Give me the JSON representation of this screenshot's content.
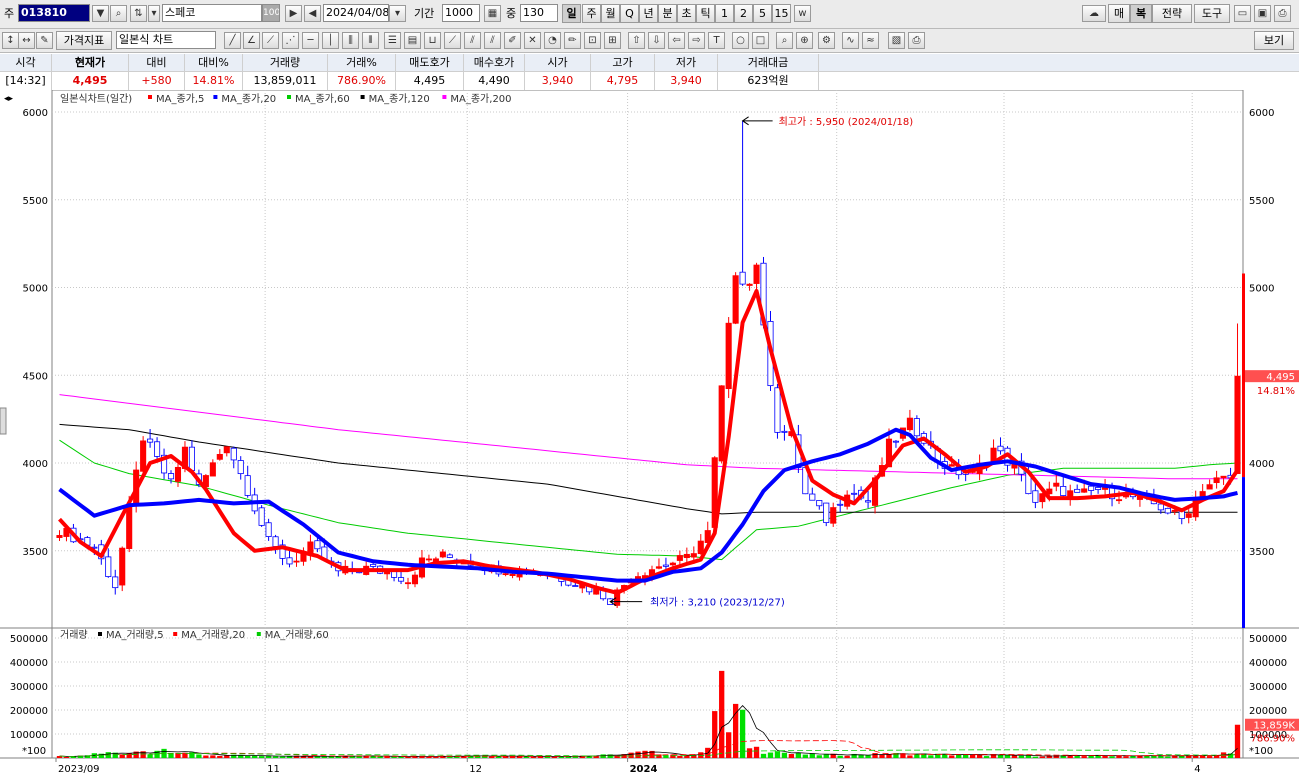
{
  "toolbar": {
    "type_label": "주",
    "code": "013810",
    "name": "스페코",
    "ratio_box": "100",
    "date": "2024/04/08",
    "period_label": "기간",
    "period_value": "1000",
    "count_label": "중",
    "count_value": "130",
    "period_tabs": [
      "일",
      "주",
      "월",
      "Q",
      "년",
      "분",
      "초",
      "틱",
      "1",
      "2",
      "5",
      "15"
    ],
    "right_buttons": [
      "매",
      "복",
      "전략",
      "도구"
    ],
    "price_indicator": "가격지표",
    "chart_style": "일본식 차트",
    "view_button": "보기"
  },
  "quote": {
    "headers": [
      "시각",
      "현재가",
      "대비",
      "대비%",
      "거래량",
      "거래%",
      "매도호가",
      "매수호가",
      "시가",
      "고가",
      "저가",
      "거래대금"
    ],
    "values": [
      "[14:32]",
      "4,495",
      "+580",
      "14.81%",
      "13,859,011",
      "786.90%",
      "4,495",
      "4,490",
      "3,940",
      "4,795",
      "3,940",
      "623억원"
    ]
  },
  "colors": {
    "up": "#ff0000",
    "down": "#0000ff",
    "ma5": "#ff0000",
    "ma20": "#0000ff",
    "ma60": "#00cc00",
    "ma120": "#000000",
    "ma200": "#ff00ff"
  },
  "chart_data": {
    "type": "candlestick",
    "title": "일본식차트(일간)",
    "legend": [
      "MA_종가,5",
      "MA_종가,20",
      "MA_종가,60",
      "MA_종가,120",
      "MA_종가,200"
    ],
    "ylim": [
      3060,
      6080
    ],
    "yticks": [
      3500,
      4000,
      4500,
      5000,
      5500,
      6000
    ],
    "ytick_labels": [
      "3500",
      "4000",
      "4500",
      "5000",
      "5500",
      "6000"
    ],
    "x_labels": [
      "2023/09",
      "11",
      "12",
      "2024",
      "2",
      "3",
      "4"
    ],
    "x_label_index": [
      0,
      30,
      59,
      82,
      112,
      136,
      163
    ],
    "n_days": 170,
    "annotations": {
      "high": "최고가 : 5,950 (2024/01/18)",
      "low": "최저가 : 3,210 (2023/12/27)"
    },
    "current_price_tag": "4,495",
    "current_change_tag": "14.81%",
    "key_points": {
      "high_price": 5950,
      "high_index": 98,
      "low_price": 3210,
      "low_index": 79,
      "last_close": 4495,
      "last_high": 4795,
      "last_low": 3940,
      "last_open": 3940
    },
    "close_anchors": [
      [
        0,
        3620
      ],
      [
        5,
        3520
      ],
      [
        8,
        3300
      ],
      [
        12,
        4150
      ],
      [
        16,
        3880
      ],
      [
        18,
        4080
      ],
      [
        20,
        3860
      ],
      [
        24,
        4120
      ],
      [
        27,
        3850
      ],
      [
        30,
        3550
      ],
      [
        33,
        3430
      ],
      [
        36,
        3520
      ],
      [
        40,
        3380
      ],
      [
        44,
        3400
      ],
      [
        48,
        3370
      ],
      [
        50,
        3330
      ],
      [
        52,
        3440
      ],
      [
        55,
        3470
      ],
      [
        58,
        3450
      ],
      [
        62,
        3400
      ],
      [
        66,
        3390
      ],
      [
        70,
        3370
      ],
      [
        74,
        3320
      ],
      [
        77,
        3270
      ],
      [
        79,
        3220
      ],
      [
        82,
        3350
      ],
      [
        85,
        3400
      ],
      [
        87,
        3420
      ],
      [
        90,
        3460
      ],
      [
        93,
        3600
      ],
      [
        95,
        4420
      ],
      [
        97,
        5100
      ],
      [
        99,
        5020
      ],
      [
        100,
        5150
      ],
      [
        101,
        4750
      ],
      [
        103,
        4200
      ],
      [
        105,
        4150
      ],
      [
        107,
        3820
      ],
      [
        110,
        3680
      ],
      [
        113,
        3850
      ],
      [
        116,
        3780
      ],
      [
        119,
        4100
      ],
      [
        122,
        4220
      ],
      [
        124,
        4150
      ],
      [
        126,
        4020
      ],
      [
        128,
        3960
      ],
      [
        131,
        3930
      ],
      [
        134,
        4080
      ],
      [
        137,
        3980
      ],
      [
        140,
        3780
      ],
      [
        143,
        3860
      ],
      [
        146,
        3810
      ],
      [
        149,
        3850
      ],
      [
        152,
        3820
      ],
      [
        155,
        3800
      ],
      [
        158,
        3750
      ],
      [
        161,
        3680
      ],
      [
        164,
        3860
      ],
      [
        166,
        3900
      ],
      [
        168,
        3915
      ],
      [
        169,
        4495
      ]
    ],
    "ma": [
      {
        "name": "MA_종가,5",
        "color": "#ff0000",
        "points": [
          [
            0,
            3680
          ],
          [
            3,
            3550
          ],
          [
            6,
            3470
          ],
          [
            9,
            3700
          ],
          [
            13,
            4000
          ],
          [
            16,
            4040
          ],
          [
            19,
            3950
          ],
          [
            21,
            3850
          ],
          [
            25,
            3600
          ],
          [
            28,
            3500
          ],
          [
            32,
            3520
          ],
          [
            37,
            3470
          ],
          [
            41,
            3390
          ],
          [
            46,
            3390
          ],
          [
            50,
            3390
          ],
          [
            54,
            3430
          ],
          [
            58,
            3440
          ],
          [
            62,
            3410
          ],
          [
            68,
            3380
          ],
          [
            73,
            3340
          ],
          [
            77,
            3290
          ],
          [
            80,
            3260
          ],
          [
            84,
            3340
          ],
          [
            88,
            3400
          ],
          [
            92,
            3450
          ],
          [
            94,
            3600
          ],
          [
            96,
            4150
          ],
          [
            98,
            4800
          ],
          [
            100,
            4980
          ],
          [
            102,
            4650
          ],
          [
            105,
            4200
          ],
          [
            108,
            3900
          ],
          [
            111,
            3820
          ],
          [
            114,
            3770
          ],
          [
            117,
            3900
          ],
          [
            121,
            4100
          ],
          [
            124,
            4140
          ],
          [
            127,
            4050
          ],
          [
            130,
            3950
          ],
          [
            133,
            3980
          ],
          [
            136,
            4050
          ],
          [
            139,
            3950
          ],
          [
            142,
            3800
          ],
          [
            146,
            3800
          ],
          [
            150,
            3810
          ],
          [
            154,
            3830
          ],
          [
            158,
            3780
          ],
          [
            161,
            3730
          ],
          [
            164,
            3790
          ],
          [
            167,
            3840
          ],
          [
            169,
            3960
          ]
        ]
      },
      {
        "name": "MA_종가,20",
        "color": "#0000ff",
        "points": [
          [
            0,
            3850
          ],
          [
            5,
            3700
          ],
          [
            10,
            3760
          ],
          [
            15,
            3770
          ],
          [
            20,
            3790
          ],
          [
            25,
            3770
          ],
          [
            30,
            3780
          ],
          [
            35,
            3650
          ],
          [
            40,
            3490
          ],
          [
            45,
            3440
          ],
          [
            50,
            3420
          ],
          [
            55,
            3410
          ],
          [
            60,
            3400
          ],
          [
            65,
            3380
          ],
          [
            70,
            3370
          ],
          [
            75,
            3350
          ],
          [
            80,
            3330
          ],
          [
            84,
            3330
          ],
          [
            88,
            3380
          ],
          [
            92,
            3400
          ],
          [
            95,
            3490
          ],
          [
            98,
            3650
          ],
          [
            101,
            3840
          ],
          [
            104,
            3960
          ],
          [
            108,
            4010
          ],
          [
            112,
            4050
          ],
          [
            116,
            4110
          ],
          [
            120,
            4190
          ],
          [
            122,
            4160
          ],
          [
            125,
            4030
          ],
          [
            128,
            3960
          ],
          [
            132,
            3990
          ],
          [
            136,
            4010
          ],
          [
            140,
            3980
          ],
          [
            144,
            3930
          ],
          [
            148,
            3880
          ],
          [
            152,
            3860
          ],
          [
            156,
            3820
          ],
          [
            160,
            3790
          ],
          [
            164,
            3800
          ],
          [
            167,
            3810
          ],
          [
            169,
            3830
          ]
        ]
      },
      {
        "name": "MA_종가,60",
        "color": "#00cc00",
        "points": [
          [
            0,
            4130
          ],
          [
            5,
            4000
          ],
          [
            10,
            3940
          ],
          [
            20,
            3870
          ],
          [
            30,
            3760
          ],
          [
            40,
            3660
          ],
          [
            50,
            3600
          ],
          [
            60,
            3560
          ],
          [
            70,
            3520
          ],
          [
            80,
            3480
          ],
          [
            90,
            3470
          ],
          [
            95,
            3450
          ],
          [
            100,
            3620
          ],
          [
            106,
            3640
          ],
          [
            112,
            3700
          ],
          [
            120,
            3780
          ],
          [
            128,
            3860
          ],
          [
            136,
            3930
          ],
          [
            144,
            3970
          ],
          [
            152,
            3970
          ],
          [
            160,
            3970
          ],
          [
            165,
            3990
          ],
          [
            169,
            4000
          ]
        ]
      },
      {
        "name": "MA_종가,120",
        "color": "#000000",
        "points": [
          [
            0,
            4220
          ],
          [
            10,
            4190
          ],
          [
            20,
            4120
          ],
          [
            30,
            4060
          ],
          [
            40,
            4000
          ],
          [
            50,
            3960
          ],
          [
            60,
            3920
          ],
          [
            70,
            3880
          ],
          [
            80,
            3810
          ],
          [
            90,
            3740
          ],
          [
            95,
            3710
          ],
          [
            100,
            3720
          ],
          [
            110,
            3720
          ],
          [
            120,
            3720
          ],
          [
            130,
            3720
          ],
          [
            140,
            3720
          ],
          [
            150,
            3720
          ],
          [
            160,
            3720
          ],
          [
            169,
            3720
          ]
        ]
      },
      {
        "name": "MA_종가,200",
        "color": "#ff00ff",
        "points": [
          [
            0,
            4390
          ],
          [
            10,
            4340
          ],
          [
            20,
            4290
          ],
          [
            30,
            4240
          ],
          [
            40,
            4190
          ],
          [
            50,
            4150
          ],
          [
            60,
            4110
          ],
          [
            70,
            4070
          ],
          [
            80,
            4030
          ],
          [
            90,
            3990
          ],
          [
            100,
            3970
          ],
          [
            110,
            3960
          ],
          [
            120,
            3950
          ],
          [
            130,
            3940
          ],
          [
            140,
            3930
          ],
          [
            150,
            3920
          ],
          [
            160,
            3910
          ],
          [
            169,
            3910
          ]
        ]
      }
    ],
    "volume": {
      "title": "거래량",
      "legend": [
        "MA_거래량,5",
        "MA_거래량,20",
        "MA_거래량,60"
      ],
      "ylim": [
        0,
        500000
      ],
      "yticks": [
        100000,
        200000,
        300000,
        400000,
        500000
      ],
      "ytick_labels": [
        "100000",
        "200000",
        "300000",
        "400000",
        "500000"
      ],
      "scale_note": "*100",
      "current_volume_tag": "13,859K",
      "current_pct_tag": "786.90%",
      "anchors": [
        [
          0,
          8000
        ],
        [
          2,
          6000
        ],
        [
          8,
          30000
        ],
        [
          9,
          15000
        ],
        [
          12,
          35000
        ],
        [
          13,
          25000
        ],
        [
          14,
          40000
        ],
        [
          15,
          45000
        ],
        [
          20,
          15000
        ],
        [
          30,
          8000
        ],
        [
          40,
          10000
        ],
        [
          50,
          8000
        ],
        [
          60,
          12000
        ],
        [
          70,
          8000
        ],
        [
          80,
          15000
        ],
        [
          84,
          30000
        ],
        [
          90,
          10000
        ],
        [
          93,
          50000
        ],
        [
          94,
          180000
        ],
        [
          95,
          480000
        ],
        [
          96,
          120000
        ],
        [
          97,
          230000
        ],
        [
          98,
          180000
        ],
        [
          99,
          60000
        ],
        [
          100,
          50000
        ],
        [
          101,
          30000
        ],
        [
          102,
          40000
        ],
        [
          105,
          20000
        ],
        [
          110,
          15000
        ],
        [
          120,
          20000
        ],
        [
          130,
          15000
        ],
        [
          140,
          10000
        ],
        [
          150,
          12000
        ],
        [
          160,
          10000
        ],
        [
          165,
          12000
        ],
        [
          168,
          25000
        ],
        [
          169,
          138590
        ]
      ]
    }
  }
}
